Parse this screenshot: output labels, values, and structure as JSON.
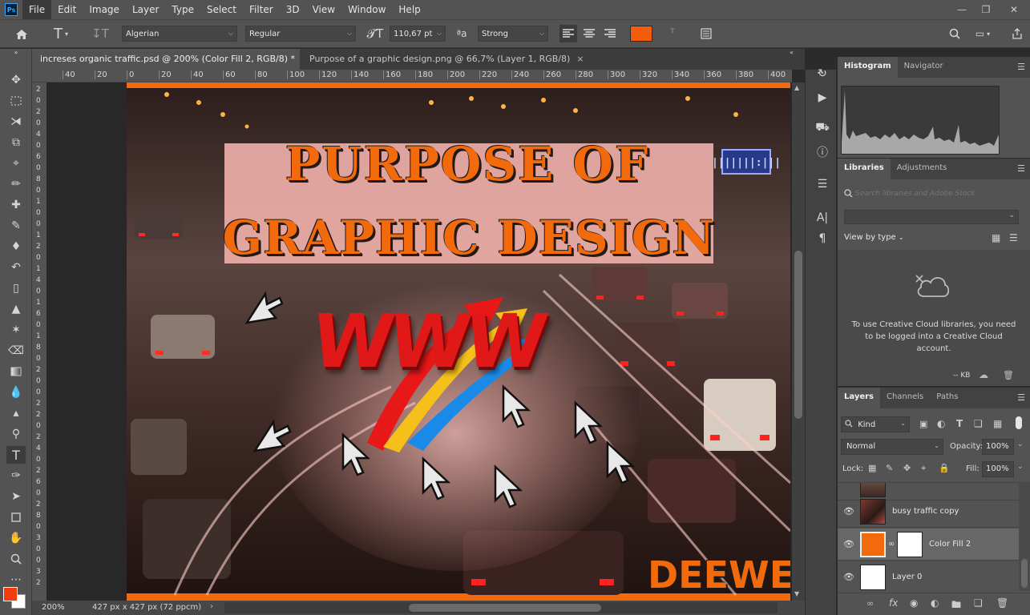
{
  "menubar": {
    "logo": "Ps",
    "items": [
      "File",
      "Edit",
      "Image",
      "Layer",
      "Type",
      "Select",
      "Filter",
      "3D",
      "View",
      "Window",
      "Help"
    ],
    "active_index": 0
  },
  "options": {
    "font_family": "Algerian",
    "font_style": "Regular",
    "font_size": "110,67 pt",
    "aa_label": "ªa",
    "antialias": "Strong",
    "text_color": "#f25c0a"
  },
  "tabs": [
    {
      "label": "increses organic traffic.psd @ 200% (Color Fill 2, RGB/8) *",
      "active": true
    },
    {
      "label": "Purpose of a graphic design.png @ 66,7% (Layer 1, RGB/8)",
      "active": false
    }
  ],
  "ruler": {
    "h_ticks": [
      "40",
      "20",
      "0",
      "20",
      "40",
      "60",
      "80",
      "100",
      "120",
      "140",
      "160",
      "180",
      "200",
      "220",
      "240",
      "260",
      "280",
      "300",
      "320",
      "340",
      "360",
      "380",
      "400"
    ],
    "v_ticks": [
      "2",
      "0",
      "2",
      "0",
      "4",
      "0",
      "6",
      "0",
      "8",
      "0",
      "1",
      "0",
      "0",
      "1",
      "2",
      "0",
      "1",
      "4",
      "0",
      "1",
      "6",
      "0",
      "1",
      "8",
      "0",
      "2",
      "0",
      "0",
      "2",
      "2",
      "0",
      "2",
      "4",
      "0",
      "2",
      "6",
      "0",
      "2",
      "8",
      "0",
      "3",
      "0",
      "0",
      "3",
      "2"
    ]
  },
  "artwork": {
    "title_line1": "PURPOSE OF",
    "title_line2": "GRAPHIC DESIGN",
    "www": "WWW",
    "brand": "DEEWEI",
    "accent": "#f26a0c"
  },
  "status": {
    "zoom": "200%",
    "doc_size": "427 px x 427 px (72 ppcm)"
  },
  "histogram_panel": {
    "tabs": [
      "Histogram",
      "Navigator"
    ]
  },
  "libraries_panel": {
    "tabs": [
      "Libraries",
      "Adjustments"
    ],
    "search_placeholder": "Search libraries and Adobe Stock",
    "view_by": "View by type",
    "message": "To use Creative Cloud libraries, you need to be logged into a Creative Cloud account.",
    "storage": "-- KB"
  },
  "layers_panel": {
    "tabs": [
      "Layers",
      "Channels",
      "Paths"
    ],
    "filter": "Kind",
    "blend_mode": "Normal",
    "opacity_label": "Opacity:",
    "opacity": "100%",
    "lock_label": "Lock:",
    "fill_label": "Fill:",
    "fill": "100%",
    "layers": [
      {
        "name": "busy traffic copy",
        "selected": false
      },
      {
        "name": "Color Fill 2",
        "selected": true
      },
      {
        "name": "Layer 0",
        "selected": false
      }
    ],
    "fill_color": "#f26a0c"
  }
}
